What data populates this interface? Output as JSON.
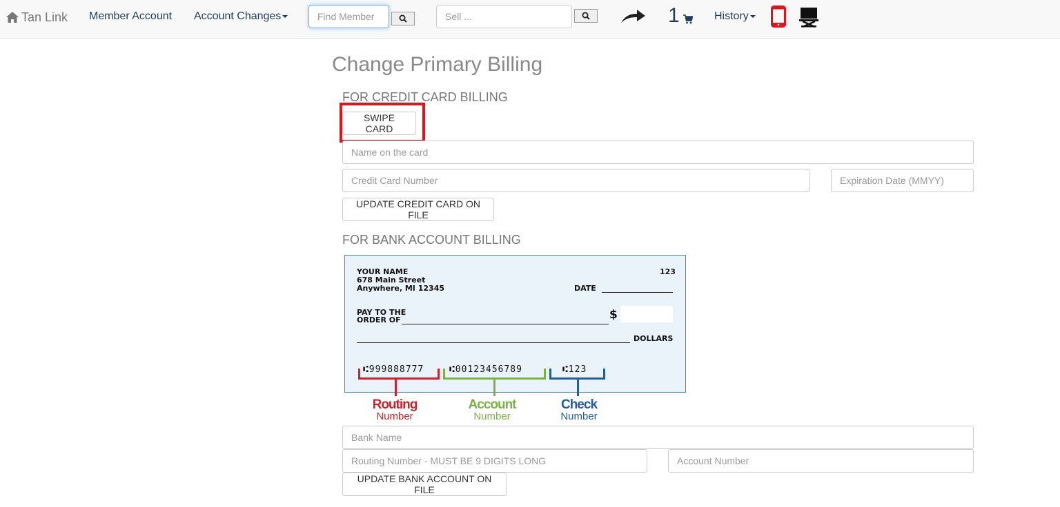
{
  "nav": {
    "brand": "Tan Link",
    "member_account": "Member Account",
    "account_changes": "Account Changes",
    "find_member_placeholder": "Find Member",
    "sell_placeholder": "Sell ...",
    "cart_count": "1",
    "history": "History"
  },
  "page": {
    "title": "Change Primary Billing"
  },
  "credit": {
    "heading": "FOR CREDIT CARD BILLING",
    "swipe_label": "SWIPE CARD",
    "name_placeholder": "Name on the card",
    "number_placeholder": "Credit Card Number",
    "expiration_placeholder": "Expiration Date (MMYY)",
    "update_label": "UPDATE CREDIT CARD ON FILE"
  },
  "bank": {
    "heading": "FOR BANK ACCOUNT BILLING",
    "bank_name_placeholder": "Bank Name",
    "routing_placeholder": "Routing Number - MUST BE 9 DIGITS LONG",
    "account_placeholder": "Account Number",
    "update_label": "UPDATE BANK ACCOUNT ON FILE"
  },
  "check": {
    "name": "YOUR NAME",
    "street": "678 Main Street",
    "city": "Anywhere, MI  12345",
    "number": "123",
    "date_label": "DATE",
    "pay_line1": "PAY TO THE",
    "pay_line2": "ORDER OF",
    "dollar_sign": "$",
    "dollars_label": "DOLLARS",
    "micr_routing": "⑆999888777",
    "micr_account": "⑆00123456789",
    "micr_check": "⑆123",
    "routing_title": "Routing",
    "routing_sub": "Number",
    "account_title": "Account",
    "account_sub": "Number",
    "check_title": "Check",
    "check_sub": "Number"
  },
  "colors": {
    "routing": "#d3202a",
    "account": "#7ab342",
    "check": "#1f5fa0",
    "highlight": "#e0141e",
    "phone_icon": "#e0141e"
  },
  "icons": [
    "home-icon",
    "search-icon",
    "arrow-icon",
    "cart-icon",
    "mobile-icon",
    "kiosk-icon"
  ]
}
